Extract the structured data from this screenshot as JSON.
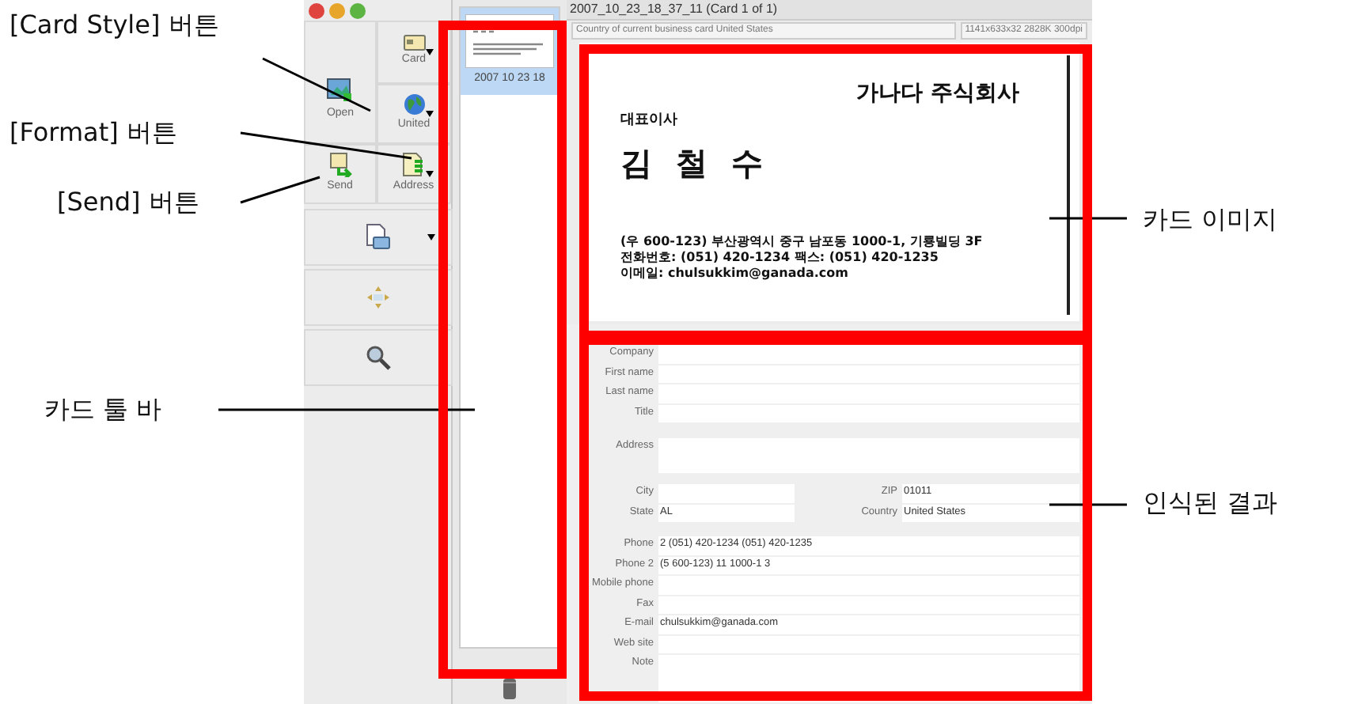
{
  "callouts": [
    {
      "text": "[Card Style] 버튼"
    },
    {
      "text": "[Format] 버튼"
    },
    {
      "text": "[Send] 버튼"
    },
    {
      "text": "카드 툴 바"
    },
    {
      "text": "카드 이미지"
    },
    {
      "text": "인식된 결과"
    }
  ],
  "toolbar": {
    "open": {
      "label": "Open",
      "menu": false
    },
    "style_buttons": [
      {
        "label": "Card",
        "menu": true
      },
      {
        "label": "United",
        "menu": true
      }
    ],
    "send_buttons": [
      {
        "label": "Send",
        "menu": false
      },
      {
        "label": "Address",
        "menu": true
      }
    ],
    "tools": [
      {
        "menu": true
      },
      {
        "menu": false
      },
      {
        "menu": false
      }
    ]
  },
  "thumbnails": [
    {
      "label": "2007 10 23 18",
      "selected": true
    }
  ],
  "document": {
    "title": "2007_10_23_18_37_11 (Card 1 of 1)",
    "info": "Country of current business card United States",
    "image_info": "1141x633x32  2828K  300dpi"
  },
  "card": {
    "company": "가나다 주식회사",
    "position": "대표이사",
    "name": "김 철 수",
    "lines": [
      "(우 600-123) 부산광역시 중구 남포동 1000-1, 기룡빌딩 3F",
      "전화번호: (051) 420-1234   팩스: (051) 420-1235",
      "이메일: chulsukkim@ganada.com"
    ]
  },
  "form": [
    {
      "kind": "line",
      "fields": [
        {
          "label": "Company"
        }
      ]
    },
    {
      "kind": "line",
      "fields": [
        {
          "label": "First name"
        }
      ]
    },
    {
      "kind": "line",
      "fields": [
        {
          "label": "Last name"
        }
      ]
    },
    {
      "kind": "line",
      "fields": [
        {
          "label": "Title"
        }
      ]
    },
    {
      "kind": "tall",
      "fields": [
        {
          "label": "Address"
        }
      ]
    },
    {
      "kind": "pair",
      "fields": [
        {
          "label": "City"
        },
        {
          "label": "ZIP",
          "value": "01011"
        }
      ]
    },
    {
      "kind": "pair",
      "fields": [
        {
          "label": "State",
          "value": "AL"
        },
        {
          "label": "Country",
          "value": "United States"
        }
      ]
    },
    {
      "kind": "line",
      "fields": [
        {
          "label": "Phone",
          "value": "2 (051) 420-1234 (051) 420-1235"
        }
      ]
    },
    {
      "kind": "line",
      "fields": [
        {
          "label": "Phone 2",
          "value": "(5 600-123) 11 1000-1 3"
        }
      ]
    },
    {
      "kind": "line",
      "fields": [
        {
          "label": "Mobile phone"
        }
      ]
    },
    {
      "kind": "line",
      "fields": [
        {
          "label": "Fax"
        }
      ]
    },
    {
      "kind": "line",
      "fields": [
        {
          "label": "E-mail",
          "value": "chulsukkim@ganada.com"
        }
      ]
    },
    {
      "kind": "line",
      "fields": [
        {
          "label": "Web site"
        }
      ]
    },
    {
      "kind": "note",
      "fields": [
        {
          "label": "Note"
        }
      ]
    }
  ]
}
